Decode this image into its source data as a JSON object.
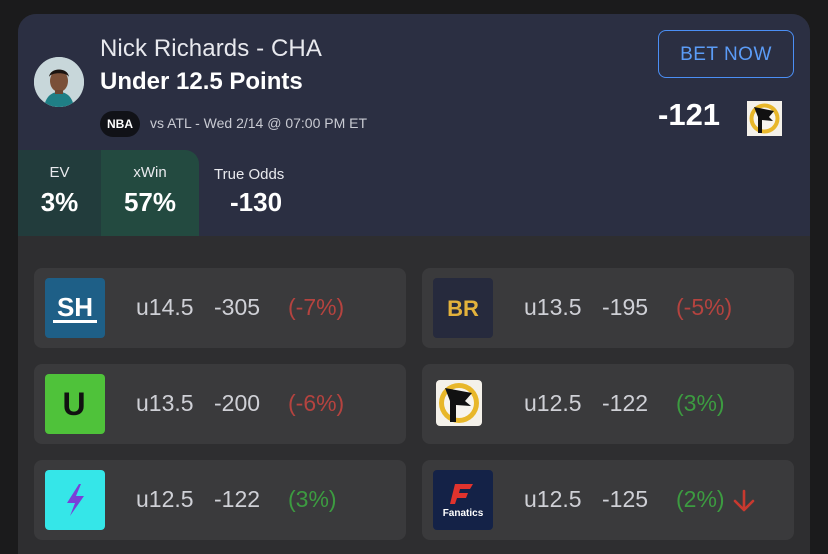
{
  "header": {
    "player": "Nick Richards - CHA",
    "market": "Under 12.5 Points",
    "league": "NBA",
    "game_info": "vs ATL - Wed 2/14 @ 07:00 PM ET",
    "bet_button": "BET NOW",
    "price": "-121",
    "price_book_icon": "flag-book-icon"
  },
  "stats": {
    "ev": {
      "label": "EV",
      "value": "3%"
    },
    "xwin": {
      "label": "xWin",
      "value": "57%"
    },
    "true_odds": {
      "label": "True Odds",
      "value": "-130"
    }
  },
  "books": [
    {
      "logo": "sh-logo",
      "logo_text": "SH",
      "line": "u14.5",
      "odds": "-305",
      "diff": "(-7%)",
      "sentiment": "negative"
    },
    {
      "logo": "br-logo",
      "logo_text": "BR",
      "line": "u13.5",
      "odds": "-195",
      "diff": "(-5%)",
      "sentiment": "negative"
    },
    {
      "logo": "u-logo",
      "logo_text": "U",
      "line": "u13.5",
      "odds": "-200",
      "diff": "(-6%)",
      "sentiment": "negative"
    },
    {
      "logo": "flag-book-logo",
      "logo_text": "",
      "line": "u12.5",
      "odds": "-122",
      "diff": "(3%)",
      "sentiment": "positive"
    },
    {
      "logo": "lightning-book-logo",
      "logo_text": "",
      "line": "u12.5",
      "odds": "-122",
      "diff": "(3%)",
      "sentiment": "positive"
    },
    {
      "logo": "fanatics-logo",
      "logo_text": "Fanatics",
      "line": "u12.5",
      "odds": "-125",
      "diff": "(2%)",
      "sentiment": "positive",
      "trend": "down-arrow-icon"
    }
  ],
  "colors": {
    "header_bg": "#2b2f42",
    "ev_bg": "#223c3c",
    "xwin_bg": "#234a40",
    "accent_blue": "#4b8ff5",
    "negative": "#b5433f",
    "positive": "#3c9b40"
  }
}
